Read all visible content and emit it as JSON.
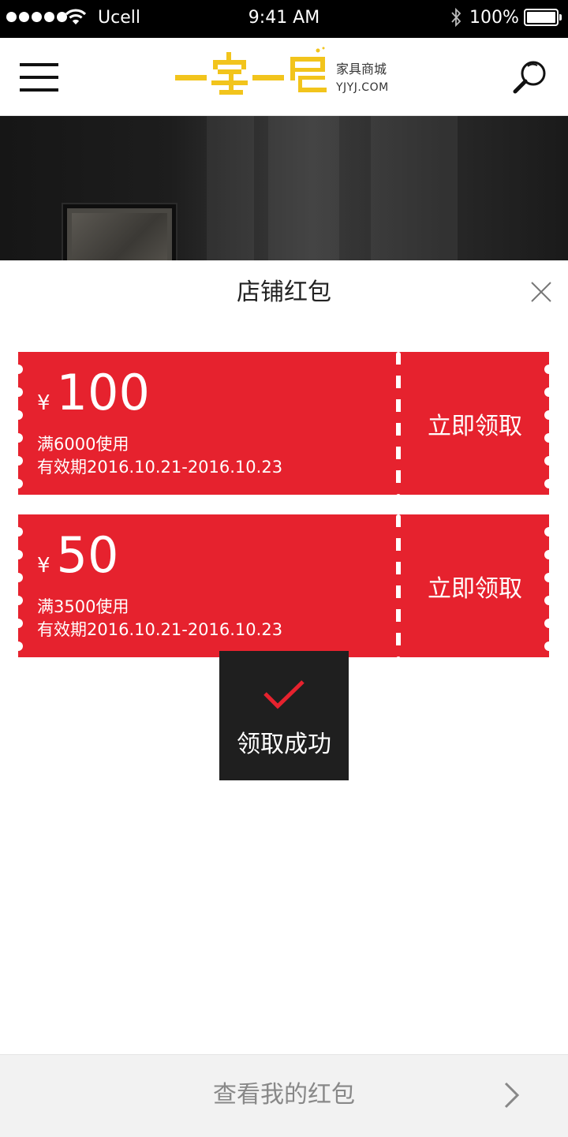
{
  "status_bar": {
    "carrier": "Ucell",
    "time": "9:41 AM",
    "battery_percent": "100%",
    "signal_bars": 5,
    "battery_level": 1.0
  },
  "header": {
    "menu_icon": "hamburger-menu-icon",
    "logo_slogan": "家具商城",
    "logo_domain": "YJYJ.COM",
    "search_icon": "magnifier-icon",
    "brand_color": "#f2c41c"
  },
  "popup": {
    "title": "店铺红包",
    "close_icon": "close-x-icon",
    "accent_color": "#e6222e",
    "coupons": [
      {
        "currency": "¥",
        "amount": "100",
        "condition": "满6000使用",
        "validity": "有效期2016.10.21-2016.10.23",
        "claim_label": "立即领取"
      },
      {
        "currency": "¥",
        "amount": "50",
        "condition": "满3500使用",
        "validity": "有效期2016.10.21-2016.10.23",
        "claim_label": "立即领取"
      }
    ]
  },
  "toast": {
    "icon": "checkmark-icon",
    "message": "领取成功"
  },
  "footer": {
    "label": "查看我的红包",
    "icon": "chevron-right-icon"
  }
}
